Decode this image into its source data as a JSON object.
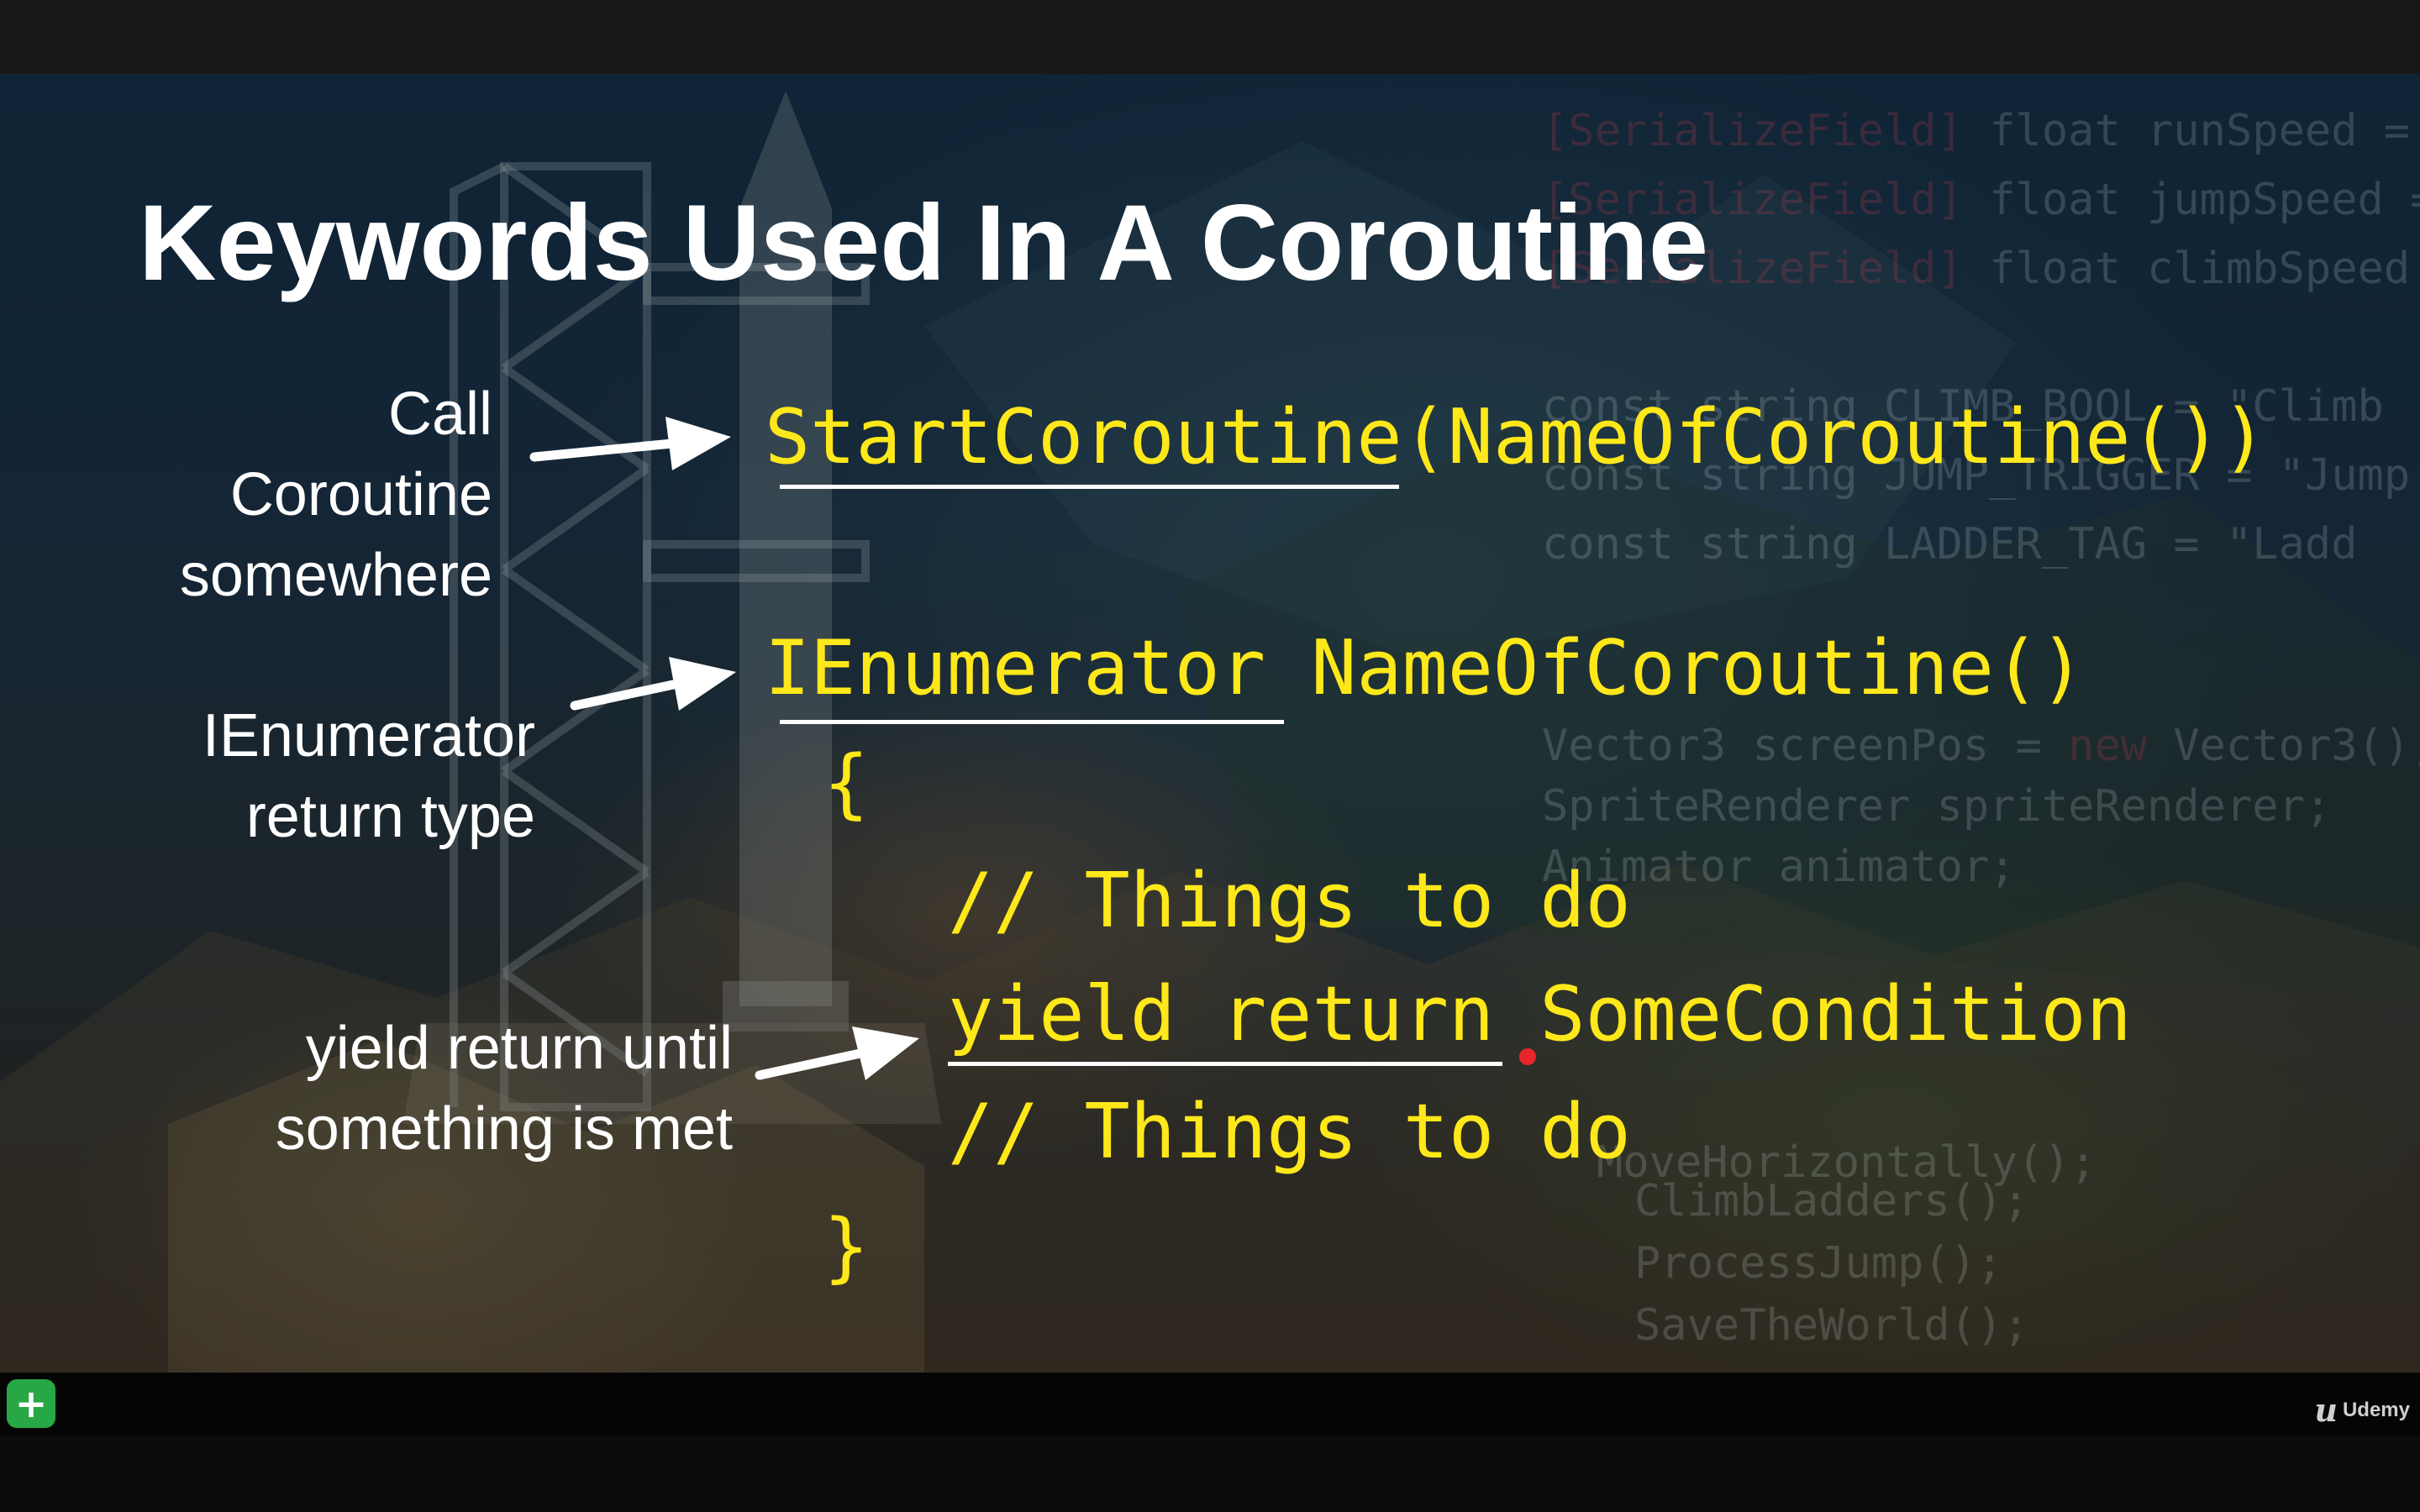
{
  "slide": {
    "title": "Keywords Used In A Coroutine",
    "labels": {
      "call": [
        "Call",
        "Coroutine",
        "somewhere"
      ],
      "ienumerator": [
        "IEnumerator",
        "return type"
      ],
      "yield": [
        "yield return until",
        "something is met"
      ]
    },
    "code": {
      "start_coroutine": "StartCoroutine(NameOfCoroutine())",
      "signature": "IEnumerator NameOfCoroutine()",
      "open_brace": "{",
      "comment_1": "// Things to do",
      "yield_line": "yield return SomeCondition",
      "comment_2": "// Things to do",
      "close_brace": "}"
    },
    "background_code": {
      "serialize_1": "[SerializeField]",
      "field_1": " float runSpeed =",
      "serialize_2": "[SerializeField]",
      "field_2": " float jumpSpeed =",
      "serialize_3": "[SerializeField]",
      "field_3": " float climbSpeed",
      "const_1": "const string CLIMB_BOOL = \"Climb",
      "const_2": "const string JUMP_TRIGGER = \"Jump",
      "const_3": "const string LADDER_TAG = \"Ladd",
      "vector_decl": "Vector3 screenPos = ",
      "vector_new": "new",
      "vector_rest": " Vector3();",
      "sprite_decl": "SpriteRenderer spriteRenderer;",
      "animator_decl": "Animator animator;",
      "move_call": "MoveHorizontally();",
      "climb_call": "ClimbLadders();",
      "jump_call": "ProcessJump();",
      "save_call": "SaveTheWorld();"
    }
  },
  "player": {
    "brand": "Udemy",
    "brand_icon": "u",
    "plus_badge": "+"
  },
  "colors": {
    "code": "#ffe81a",
    "text": "#ffffff",
    "serialize_keyword": "#e04050",
    "plus_badge": "#27a844"
  }
}
